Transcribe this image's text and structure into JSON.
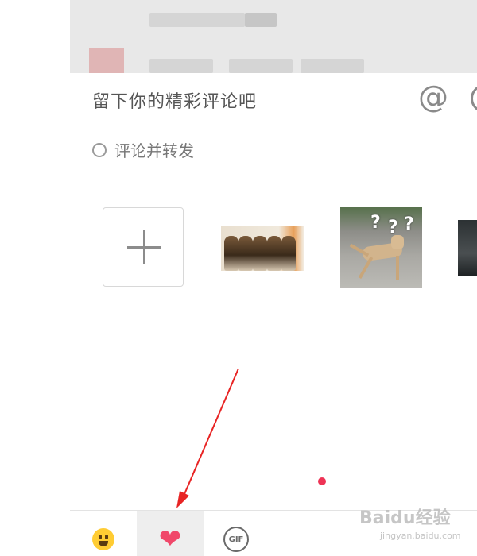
{
  "composer": {
    "placeholder": "留下你的精彩评论吧",
    "mention_symbol": "@",
    "repost_label": "评论并转发"
  },
  "stickers": {
    "add_symbol": "+",
    "items": [
      {
        "icon": "cats-sticker"
      },
      {
        "icon": "dog-question-sticker",
        "caption": "?"
      },
      {
        "icon": "partial-sticker"
      }
    ],
    "dog_marks": [
      "?",
      "?",
      "?"
    ]
  },
  "toolbar": {
    "tabs": [
      {
        "icon": "emoji-icon"
      },
      {
        "icon": "heart-icon",
        "selected": true
      },
      {
        "icon": "gif-icon",
        "label": "GIF"
      }
    ]
  },
  "colors": {
    "accent": "#f0486a",
    "annotation_arrow": "#e82424",
    "notice_dot": "#ee3355"
  },
  "watermark": {
    "brand": "Baidu经验",
    "url": "jingyan.baidu.com"
  }
}
